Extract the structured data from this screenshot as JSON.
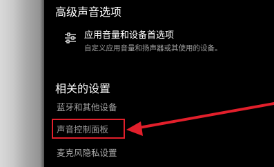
{
  "advanced_section": {
    "title": "高级声音选项",
    "option": {
      "icon": "sliders-icon",
      "title": "应用音量和设备首选项",
      "description": "自定义应用音量和扬声器或其使用的设备。"
    }
  },
  "related_section": {
    "title": "相关的设置",
    "links": [
      {
        "label": "蓝牙和其他设备"
      },
      {
        "label": "声音控制面板"
      },
      {
        "label": "麦克风隐私设置"
      }
    ]
  },
  "annotation": {
    "color": "#e21f2b",
    "highlighted_link": "声音控制面板"
  }
}
